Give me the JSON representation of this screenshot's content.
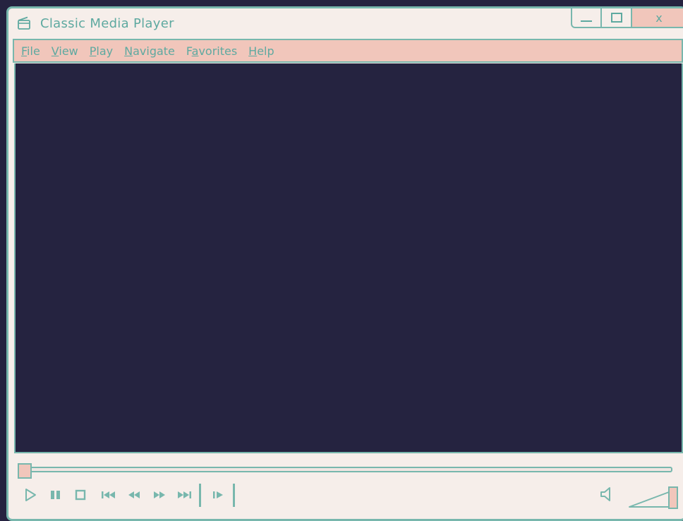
{
  "window": {
    "title": "Classic Media Player",
    "controls": {
      "minimize_icon": "minimize-icon",
      "maximize_icon": "maximize-icon",
      "close_label": "x"
    }
  },
  "menubar": {
    "items": [
      {
        "label": "File",
        "accel": "F",
        "rest": "ile"
      },
      {
        "label": "View",
        "accel": "V",
        "rest": "iew"
      },
      {
        "label": "Play",
        "accel": "P",
        "rest": "lay"
      },
      {
        "label": "Navigate",
        "accel": "N",
        "rest": "avigate"
      },
      {
        "label": "Favorites",
        "accel": "a",
        "prefix": "F",
        "rest": "vorites"
      },
      {
        "label": "Help",
        "accel": "H",
        "rest": "elp"
      }
    ]
  },
  "playback": {
    "seek_position": 0.0,
    "volume_level": 1.0,
    "controls": [
      "play-icon",
      "pause-icon",
      "stop-icon",
      "skip-back-icon",
      "rewind-icon",
      "fast-forward-icon",
      "skip-forward-icon",
      "frame-step-icon",
      "volume-icon"
    ]
  },
  "colors": {
    "accent": "#78b7ad",
    "text": "#5ea9a0",
    "highlight": "#f1c6bb",
    "window_bg": "#f6eeea",
    "video_bg": "#252340"
  }
}
